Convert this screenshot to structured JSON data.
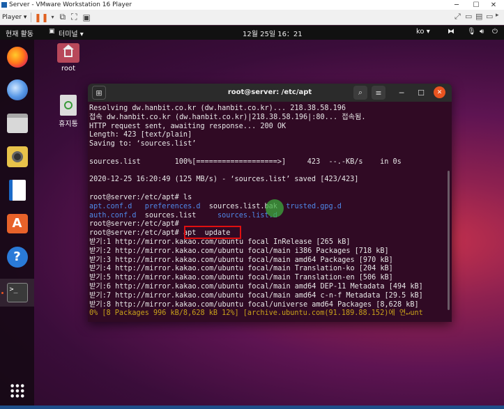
{
  "vmware": {
    "title": "Server - VMware Workstation 16 Player",
    "player_menu": "Player ▾"
  },
  "panel": {
    "activities": "현재 활동",
    "app_menu": "터미널 ▾",
    "clock": "12월 25일  16：21",
    "input_method": "ko ▾"
  },
  "desktop_icons": [
    {
      "label": "root",
      "icon": "home-folder-icon"
    },
    {
      "label": "휴지통",
      "icon": "trash-icon"
    }
  ],
  "dock": [
    {
      "name": "firefox",
      "icon": "firefox-icon"
    },
    {
      "name": "thunderbird",
      "icon": "mail-icon"
    },
    {
      "name": "files",
      "icon": "folder-icon"
    },
    {
      "name": "rhythmbox",
      "icon": "speaker-icon"
    },
    {
      "name": "writer",
      "icon": "document-icon"
    },
    {
      "name": "software",
      "icon": "store-icon"
    },
    {
      "name": "help",
      "icon": "help-icon"
    },
    {
      "name": "terminal",
      "icon": "terminal-icon"
    },
    {
      "name": "apps",
      "icon": "grid-icon"
    }
  ],
  "terminal": {
    "title": "root@server: /etc/apt",
    "lines": [
      "Resolving dw.hanbit.co.kr (dw.hanbit.co.kr)... 218.38.58.196",
      "접속 dw.hanbit.co.kr (dw.hanbit.co.kr)|218.38.58.196|:80... 접속됨.",
      "HTTP request sent, awaiting response... 200 OK",
      "Length: 423 [text/plain]",
      "Saving to: ‘sources.list’",
      "",
      "sources.list        100%[===================>]     423  --.-KB/s    in 0s",
      "",
      "2020-12-25 16:20:49 (125 MB/s) - ‘sources.list’ saved [423/423]",
      "",
      "root@server:/etc/apt# ls"
    ],
    "ls_row1": [
      "apt.conf.d",
      "preferences.d",
      "sources.list.bak",
      "trusted.gpg.d"
    ],
    "ls_row2": [
      "auth.conf.d",
      "sources.list",
      "sources.list.d"
    ],
    "prompt": "root@server:/etc/apt#",
    "command": "apt  update",
    "update_lines": [
      "받기:1 http://mirror.kakao.com/ubuntu focal InRelease [265 kB]",
      "받기:2 http://mirror.kakao.com/ubuntu focal/main i386 Packages [718 kB]",
      "받기:3 http://mirror.kakao.com/ubuntu focal/main amd64 Packages [970 kB]",
      "받기:4 http://mirror.kakao.com/ubuntu focal/main Translation-ko [204 kB]",
      "받기:5 http://mirror.kakao.com/ubuntu focal/main Translation-en [506 kB]",
      "받기:6 http://mirror.kakao.com/ubuntu focal/main amd64 DEP-11 Metadata [494 kB]",
      "받기:7 http://mirror.kakao.com/ubuntu focal/main amd64 c-n-f Metadata [29.5 kB]",
      "받기:8 http://mirror.kakao.com/ubuntu focal/universe amd64 Packages [8,628 kB]"
    ],
    "progress_line": "0% [8 Packages 996 kB/8,628 kB 12%] [archive.ubuntu.com(91.189.88.152)에 연↵unt"
  },
  "colors": {
    "terminal_bg": "#300a24",
    "dir_blue": "#4f88e8",
    "progress_yellow": "#c9a21a",
    "highlight_red": "#e01010"
  }
}
